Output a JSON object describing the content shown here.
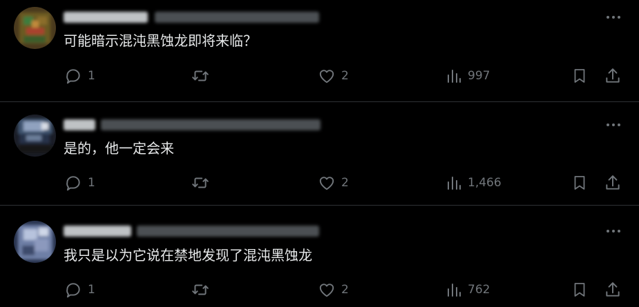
{
  "colors": {
    "background": "#000000",
    "text_primary": "#e7e9ea",
    "text_secondary": "#71767b",
    "divider": "#2f3336"
  },
  "icons": {
    "reply": "speech-bubble-icon",
    "repost": "repost-arrows-icon",
    "like": "heart-icon",
    "views": "bar-chart-icon",
    "bookmark": "bookmark-icon",
    "share": "share-upload-icon",
    "more": "more-dots-icon"
  },
  "posts": [
    {
      "text": "可能暗示混沌黑蚀龙即将来临？",
      "reply_count": "1",
      "like_count": "2",
      "view_count": "997"
    },
    {
      "text": "是的，他一定会来",
      "reply_count": "1",
      "like_count": "2",
      "view_count": "1,466"
    },
    {
      "text": "我只是以为它说在禁地发现了混沌黑蚀龙",
      "reply_count": "1",
      "like_count": "2",
      "view_count": "762"
    }
  ]
}
